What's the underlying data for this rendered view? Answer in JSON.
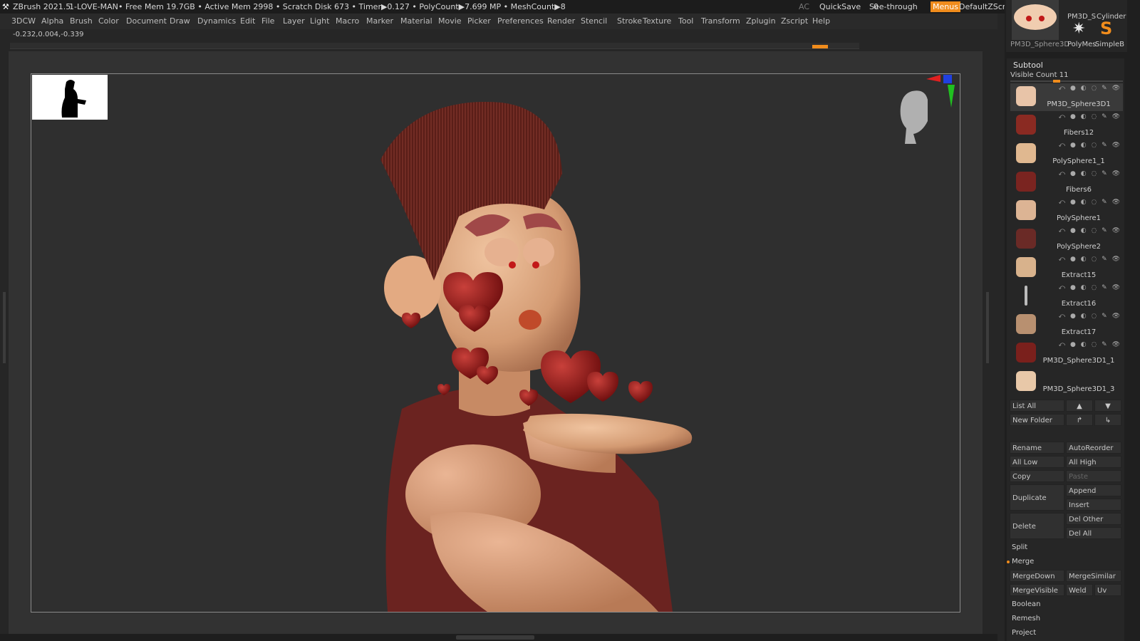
{
  "titlebar": {
    "app": "ZBrush 2021.5",
    "doc": "1-LOVE-MAN",
    "stats": "• Free Mem 19.7GB • Active Mem 2998 • Scratch Disk 673 •  Timer▶0.127 • PolyCount▶7.699 MP  • MeshCount▶8",
    "ac": "AC",
    "quicksave": "QuickSave",
    "seethrough": "See-through",
    "seethrough_val": "0",
    "menus": "Menus",
    "defaultzscript": "DefaultZScript"
  },
  "menubar": [
    "3DCW",
    "Alpha",
    "Brush",
    "Color",
    "Document",
    "Draw",
    "Dynamics",
    "Edit",
    "File",
    "Layer",
    "Light",
    "Macro",
    "Marker",
    "Material",
    "Movie",
    "Picker",
    "Preferences",
    "Render",
    "Stencil",
    "Stroke",
    "Texture",
    "Tool",
    "Transform",
    "Zplugin",
    "Zscript",
    "Help"
  ],
  "coords": "-0.232,0.004,-0.339",
  "tool_thumbs": {
    "main_label": "PM3D_Sphere3D",
    "small1_label": "PolyMes",
    "small2_label": "SimpleB",
    "top_label": "PM3D_S",
    "cylinder_label": "Cylinder"
  },
  "subtool": {
    "title": "Subtool",
    "visible_count_label": "Visible Count",
    "visible_count": "11",
    "items": [
      {
        "name": "PM3D_Sphere3D1",
        "color": "#e8c4a8"
      },
      {
        "name": "Fibers12",
        "color": "#8a2a22"
      },
      {
        "name": "PolySphere1_1",
        "color": "#e0b890"
      },
      {
        "name": "Fibers6",
        "color": "#7a2420"
      },
      {
        "name": "PolySphere1",
        "color": "#dcb494"
      },
      {
        "name": "PolySphere2",
        "color": "#6a2a26"
      },
      {
        "name": "Extract15",
        "color": "#d8b28c"
      },
      {
        "name": "Extract16",
        "color": "#bbbbbb"
      },
      {
        "name": "Extract17",
        "color": "#b89070"
      },
      {
        "name": "PM3D_Sphere3D1_1",
        "color": "#7a201c"
      },
      {
        "name": "PM3D_Sphere3D1_3",
        "color": "#e8c8a8"
      }
    ]
  },
  "buttons": {
    "list_all": "List All",
    "new_folder": "New Folder",
    "rename": "Rename",
    "autoreorder": "AutoReorder",
    "all_low": "All Low",
    "all_high": "All High",
    "copy": "Copy",
    "paste": "Paste",
    "duplicate": "Duplicate",
    "append": "Append",
    "insert": "Insert",
    "delete": "Delete",
    "del_other": "Del Other",
    "del_all": "Del All",
    "split": "Split",
    "merge": "Merge",
    "mergedown": "MergeDown",
    "mergesimilar": "MergeSimilar",
    "mergevisible": "MergeVisible",
    "weld": "Weld",
    "uv": "Uv",
    "boolean": "Boolean",
    "remesh": "Remesh",
    "project": "Project"
  },
  "colors": {
    "accent": "#f08c1c",
    "skin": "#d9a27a",
    "shirt": "#6b2320",
    "hair": "#6a2a22",
    "heart": "#9a1a18"
  },
  "icons": [
    "zbrush-logo-icon",
    "up-arrow-icon",
    "down-arrow-icon",
    "folder-move-icon",
    "folder-out-icon",
    "gizmo-head-icon",
    "axis-icon",
    "eye-icon"
  ]
}
